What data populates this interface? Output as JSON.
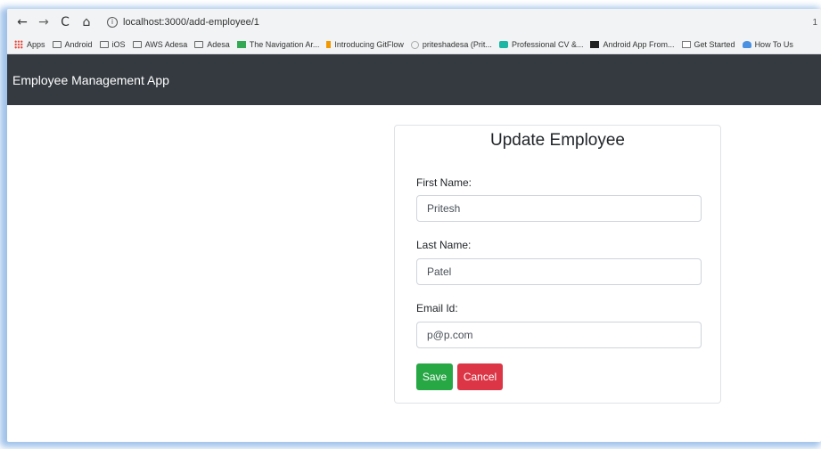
{
  "browser": {
    "url": "localhost:3000/add-employee/1",
    "url_end": "1",
    "bookmarks": [
      {
        "label": "Apps",
        "icon": "apps-grid-icon"
      },
      {
        "label": "Android",
        "icon": "folder-icon"
      },
      {
        "label": "iOS",
        "icon": "folder-icon"
      },
      {
        "label": "AWS Adesa",
        "icon": "folder-icon"
      },
      {
        "label": "Adesa",
        "icon": "folder-icon"
      },
      {
        "label": "The Navigation Ar...",
        "icon": "site-icon"
      },
      {
        "label": "Introducing GitFlow",
        "icon": "site-icon"
      },
      {
        "label": "priteshadesa (Prit...",
        "icon": "github-icon"
      },
      {
        "label": "Professional CV &...",
        "icon": "site-icon"
      },
      {
        "label": "Android App From...",
        "icon": "medium-icon"
      },
      {
        "label": "Get Started",
        "icon": "site-icon"
      },
      {
        "label": "How To Us",
        "icon": "site-icon"
      }
    ]
  },
  "navbar": {
    "brand": "Employee Management App"
  },
  "form": {
    "title": "Update Employee",
    "first_name_label": "First Name:",
    "first_name_value": "Pritesh",
    "last_name_label": "Last Name:",
    "last_name_value": "Patel",
    "email_label": "Email Id:",
    "email_value": "p@p.com",
    "save_label": "Save",
    "cancel_label": "Cancel"
  },
  "colors": {
    "navbar_bg": "#343a40",
    "save_bg": "#28a745",
    "cancel_bg": "#dc3545"
  }
}
